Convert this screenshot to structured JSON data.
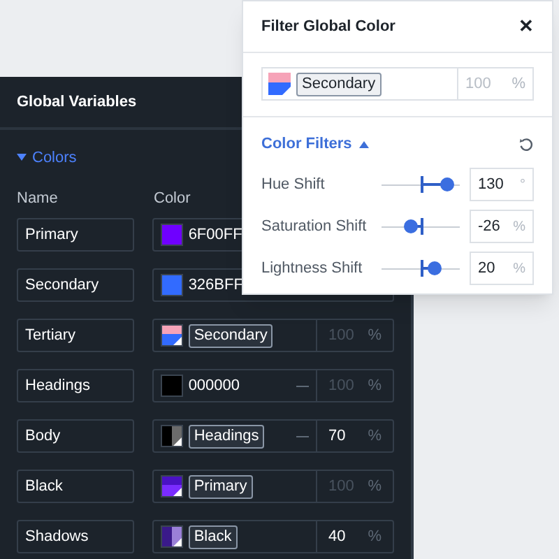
{
  "panel": {
    "title": "Global Variables",
    "section": {
      "label": "Colors",
      "expanded": true
    },
    "columns": [
      "Name",
      "Color"
    ],
    "rows": [
      {
        "name": "Primary",
        "swatch": {
          "kind": "solid",
          "color": "#6f00ff"
        },
        "value": "6F00FF"
      },
      {
        "name": "Secondary",
        "swatch": {
          "kind": "solid",
          "color": "#326bff"
        },
        "value": "326BFF"
      },
      {
        "name": "Tertiary",
        "swatch": {
          "kind": "linked",
          "parts": [
            {
              "color": "#f6a3b8"
            },
            {
              "color": "#326bff"
            }
          ]
        },
        "tag": "Secondary",
        "clearable": false,
        "opacity": "100",
        "dimmed": true,
        "unit": "%"
      },
      {
        "name": "Headings",
        "swatch": {
          "kind": "solid",
          "color": "#000000"
        },
        "value": "000000",
        "clearable": true,
        "opacity": "100",
        "dimmed": true,
        "unit": "%"
      },
      {
        "name": "Body",
        "swatch": {
          "kind": "split",
          "parts": [
            {
              "color": "#000000"
            },
            {
              "color": "#6b6b6b"
            }
          ]
        },
        "tag": "Headings",
        "clearable": true,
        "opacity": "70",
        "dimmed": false,
        "unit": "%"
      },
      {
        "name": "Black",
        "swatch": {
          "kind": "linked",
          "parts": [
            {
              "color": "#4a12c4"
            },
            {
              "color": "#7a2cff"
            }
          ]
        },
        "tag": "Primary",
        "clearable": false,
        "opacity": "100",
        "dimmed": true,
        "unit": "%"
      },
      {
        "name": "Shadows",
        "swatch": {
          "kind": "split",
          "parts": [
            {
              "color": "#3a1a8a"
            },
            {
              "color": "#9a80d8"
            }
          ]
        },
        "tag": "Black",
        "clearable": false,
        "opacity": "40",
        "dimmed": false,
        "unit": "%"
      }
    ]
  },
  "popup": {
    "title": "Filter Global Color",
    "close": "✕",
    "field": {
      "swatch": {
        "kind": "linked",
        "parts": [
          {
            "color": "#f6a3b8"
          },
          {
            "color": "#326bff"
          }
        ]
      },
      "tag": "Secondary",
      "opacity": "100",
      "dimmed": true,
      "unit": "%"
    },
    "filters": {
      "label": "Color Filters",
      "expanded": true
    },
    "sliders": [
      {
        "label": "Hue Shift",
        "level": 0.84,
        "value": "130",
        "unit": "°"
      },
      {
        "label": "Saturation Shift",
        "level": 0.38,
        "value": "-26",
        "unit": "%"
      },
      {
        "label": "Lightness Shift",
        "level": 0.67,
        "value": "20",
        "unit": "%"
      }
    ]
  }
}
